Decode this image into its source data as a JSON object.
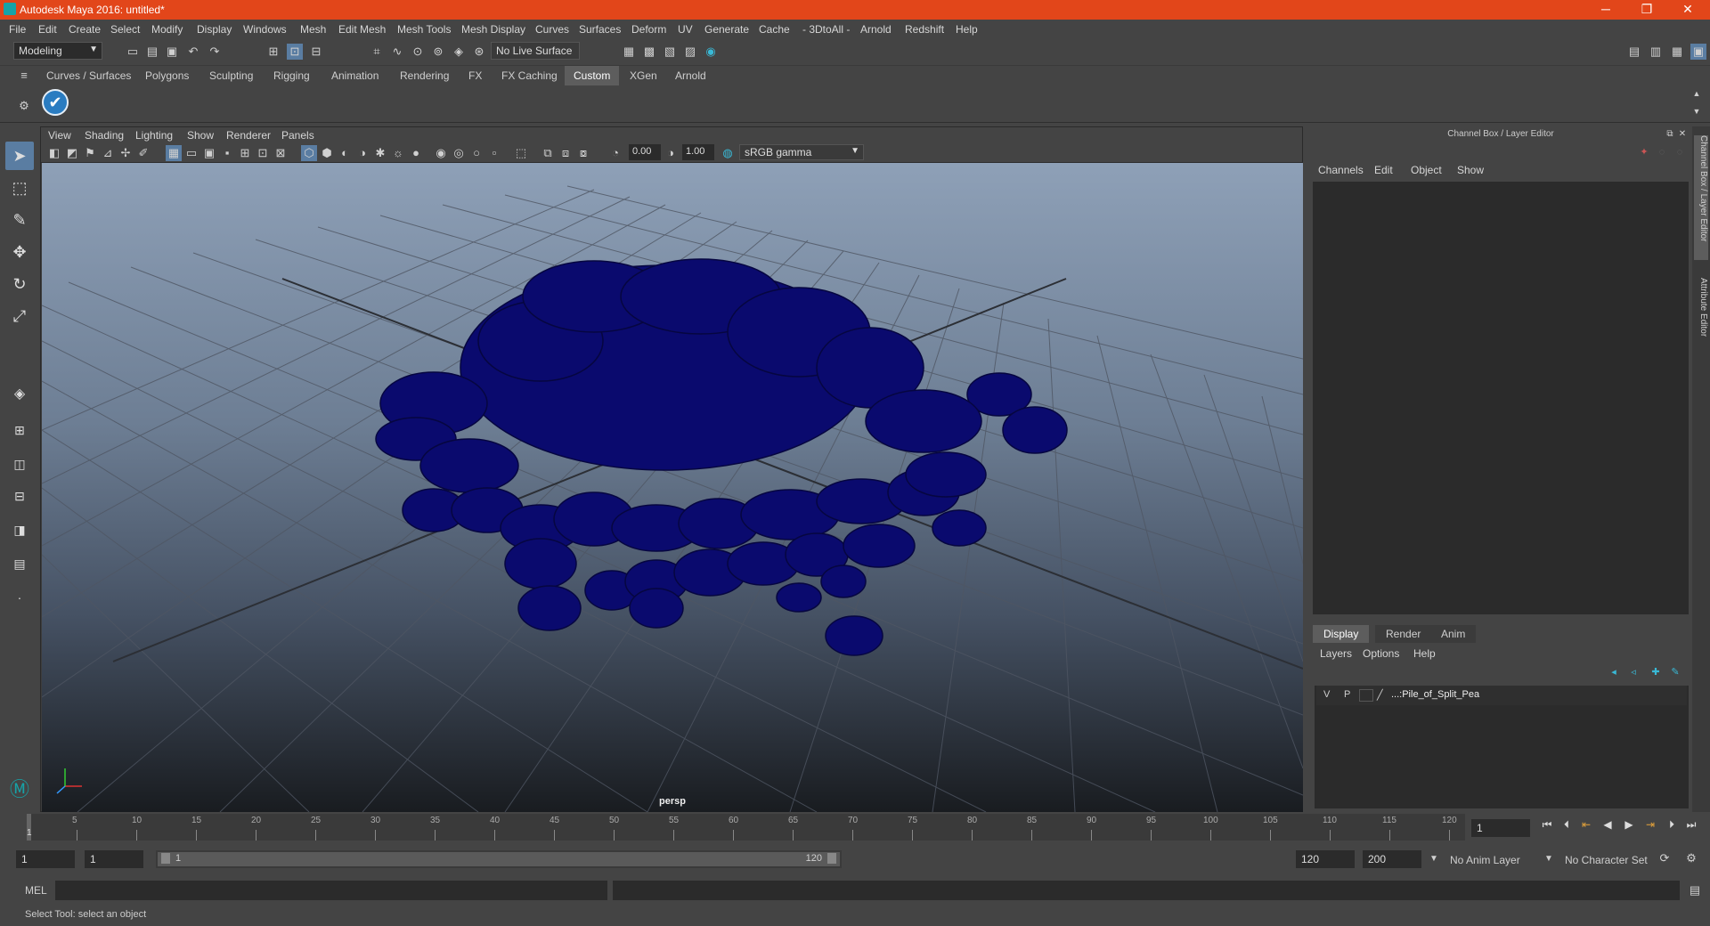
{
  "window": {
    "title": "Autodesk Maya 2016: untitled*",
    "minimize_glyph": "─",
    "restore_glyph": "❐",
    "close_glyph": "✕"
  },
  "menubar": [
    "File",
    "Edit",
    "Create",
    "Select",
    "Modify",
    "Display",
    "Windows",
    "Mesh",
    "Edit Mesh",
    "Mesh Tools",
    "Mesh Display",
    "Curves",
    "Surfaces",
    "Deform",
    "UV",
    "Generate",
    "Cache",
    "- 3DtoAll -",
    "Arnold",
    "Redshift",
    "Help"
  ],
  "statusline": {
    "mode": "Modeling",
    "live_surface": "No Live Surface"
  },
  "shelf_tabs": [
    "Curves / Surfaces",
    "Polygons",
    "Sculpting",
    "Rigging",
    "Animation",
    "Rendering",
    "FX",
    "FX Caching",
    "Custom",
    "XGen",
    "Arnold"
  ],
  "shelf_active_tab": "Custom",
  "viewport": {
    "menus": [
      "View",
      "Shading",
      "Lighting",
      "Show",
      "Renderer",
      "Panels"
    ],
    "exposure": "0.00",
    "gamma": "1.00",
    "color_space": "sRGB gamma",
    "camera_label": "persp",
    "mesh_color": "#0a0a6e"
  },
  "channel_box": {
    "header": "Channel Box / Layer Editor",
    "menus": [
      "Channels",
      "Edit",
      "Object",
      "Show"
    ]
  },
  "layer_editor": {
    "tabs": [
      "Display",
      "Render",
      "Anim"
    ],
    "active_tab": "Display",
    "menus": [
      "Layers",
      "Options",
      "Help"
    ],
    "layers": [
      {
        "v": "V",
        "p": "P",
        "name": "...:Pile_of_Split_Pea"
      }
    ]
  },
  "side_tabs": [
    "Channel Box / Layer Editor",
    "Attribute Editor"
  ],
  "timeslider": {
    "ticks": [
      "5",
      "10",
      "15",
      "20",
      "25",
      "30",
      "35",
      "40",
      "45",
      "50",
      "55",
      "60",
      "65",
      "70",
      "75",
      "80",
      "85",
      "90",
      "95",
      "100",
      "105",
      "110",
      "115",
      "120"
    ],
    "start_label": "1",
    "current_frame": "1"
  },
  "range": {
    "start": "1",
    "inner_start": "1",
    "slider_start": "1",
    "slider_end": "120",
    "end": "120",
    "outer_end": "200",
    "anim_layer": "No Anim Layer",
    "character_set": "No Character Set"
  },
  "cmdline": {
    "label": "MEL"
  },
  "helpline": {
    "text": "Select Tool: select an object"
  }
}
